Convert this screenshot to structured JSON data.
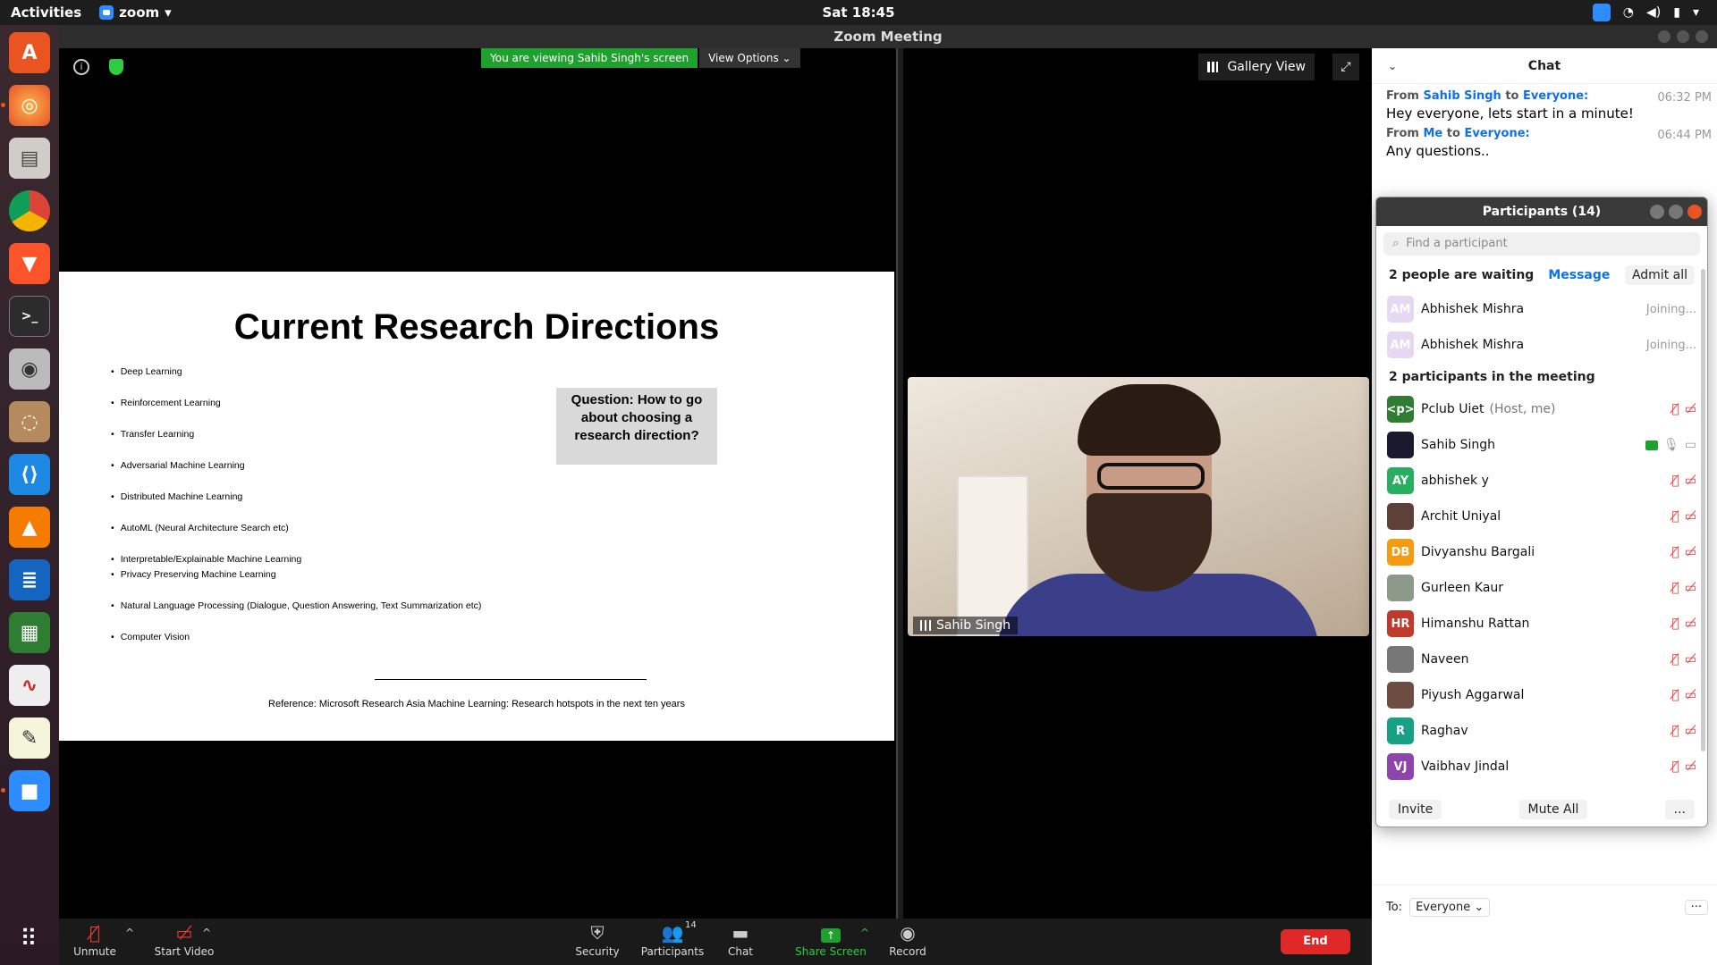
{
  "system": {
    "activities": "Activities",
    "app_name": "zoom",
    "clock": "Sat 18:45"
  },
  "window": {
    "title": "Zoom Meeting"
  },
  "share": {
    "banner": "You are viewing Sahib Singh's screen",
    "view_options": "View Options ⌄",
    "slide": {
      "title": "Current Research Directions",
      "bullets": [
        "Deep Learning",
        "Reinforcement Learning",
        "Transfer Learning",
        "Adversarial Machine Learning",
        "Distributed Machine Learning",
        "AutoML (Neural Architecture Search etc)",
        "Interpretable/Explainable Machine Learning",
        "Privacy Preserving Machine Learning",
        "Natural Language Processing (Dialogue, Question Answering, Text Summarization etc)",
        "Computer Vision"
      ],
      "question": "Question: How to go about choosing a research direction?",
      "reference": "Reference: Microsoft Research Asia Machine Learning: Research hotspots in the next ten years"
    }
  },
  "video": {
    "gallery_view": "Gallery View",
    "participant_name": "Sahib Singh"
  },
  "chat": {
    "header": "Chat",
    "messages": [
      {
        "from_label": "From",
        "from": "Sahib Singh",
        "to_label": "to",
        "to": "Everyone:",
        "time": "06:32 PM",
        "text": "Hey everyone, lets start in a minute!"
      },
      {
        "from_label": "From",
        "from": "Me",
        "to_label": "to",
        "to": "Everyone:",
        "time": "06:44 PM",
        "text": "Any questions.."
      }
    ],
    "to_label": "To:",
    "to_value": "Everyone ⌄",
    "more": "···"
  },
  "participants": {
    "title": "Participants (14)",
    "search_placeholder": "Find a participant",
    "waiting_text": "2 people are waiting",
    "message_btn": "Message",
    "admit_all": "Admit all",
    "waiting": [
      {
        "initials": "AM",
        "name": "Abhishek Mishra",
        "status": "Joining..."
      },
      {
        "initials": "AM",
        "name": "Abhishek Mishra",
        "status": "Joining..."
      }
    ],
    "in_meeting_text": "2 participants in the meeting",
    "members": [
      {
        "initials": "<p>",
        "name": "Pclub Uiet",
        "note": "(Host, me)",
        "color": "#2e7d32"
      },
      {
        "initials": "",
        "name": "Sahib Singh",
        "note": "",
        "color": "#1a1a2e"
      },
      {
        "initials": "AY",
        "name": "abhishek y",
        "note": "",
        "color": "#27ae60"
      },
      {
        "initials": "",
        "name": "Archit Uniyal",
        "note": "",
        "color": "#5d4037"
      },
      {
        "initials": "DB",
        "name": "Divyanshu Bargali",
        "note": "",
        "color": "#f39c12"
      },
      {
        "initials": "",
        "name": "Gurleen Kaur",
        "note": "",
        "color": "#8d9a8a"
      },
      {
        "initials": "HR",
        "name": "Himanshu Rattan",
        "note": "",
        "color": "#c0392b"
      },
      {
        "initials": "",
        "name": "Naveen",
        "note": "",
        "color": "#777777"
      },
      {
        "initials": "",
        "name": "Piyush Aggarwal",
        "note": "",
        "color": "#6d4c41"
      },
      {
        "initials": "R",
        "name": "Raghav",
        "note": "",
        "color": "#16a085"
      },
      {
        "initials": "VJ",
        "name": "Vaibhav Jindal",
        "note": "",
        "color": "#8e44ad"
      }
    ],
    "invite": "Invite",
    "mute_all": "Mute All",
    "more": "..."
  },
  "toolbar": {
    "unmute": "Unmute",
    "start_video": "Start Video",
    "security": "Security",
    "participants": "Participants",
    "participants_count": "14",
    "chat": "Chat",
    "share_screen": "Share Screen",
    "record": "Record",
    "end": "End"
  },
  "colors": {
    "zoom_blue": "#0e71eb",
    "share_green": "#1fa12e",
    "end_red": "#e02828"
  }
}
